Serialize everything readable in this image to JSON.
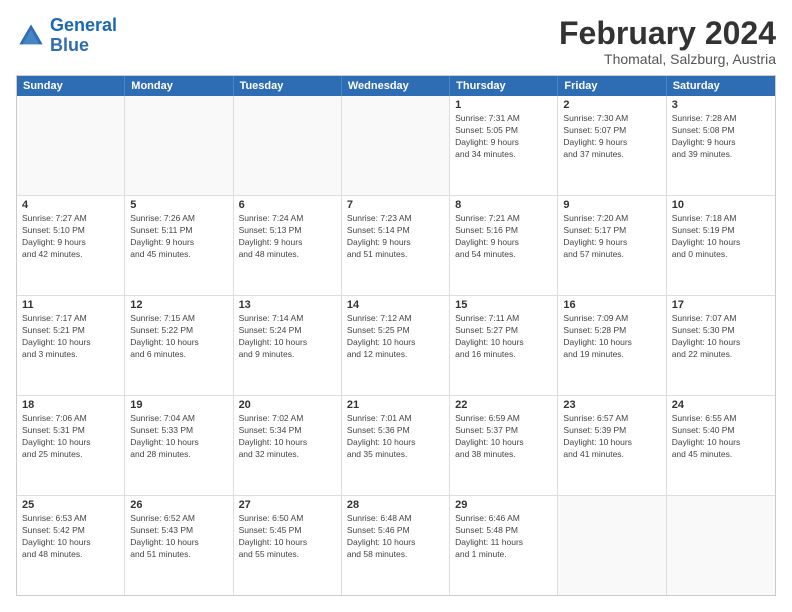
{
  "logo": {
    "line1": "General",
    "line2": "Blue"
  },
  "header": {
    "title": "February 2024",
    "subtitle": "Thomatal, Salzburg, Austria"
  },
  "weekdays": [
    "Sunday",
    "Monday",
    "Tuesday",
    "Wednesday",
    "Thursday",
    "Friday",
    "Saturday"
  ],
  "rows": [
    [
      {
        "day": "",
        "info": ""
      },
      {
        "day": "",
        "info": ""
      },
      {
        "day": "",
        "info": ""
      },
      {
        "day": "",
        "info": ""
      },
      {
        "day": "1",
        "info": "Sunrise: 7:31 AM\nSunset: 5:05 PM\nDaylight: 9 hours\nand 34 minutes."
      },
      {
        "day": "2",
        "info": "Sunrise: 7:30 AM\nSunset: 5:07 PM\nDaylight: 9 hours\nand 37 minutes."
      },
      {
        "day": "3",
        "info": "Sunrise: 7:28 AM\nSunset: 5:08 PM\nDaylight: 9 hours\nand 39 minutes."
      }
    ],
    [
      {
        "day": "4",
        "info": "Sunrise: 7:27 AM\nSunset: 5:10 PM\nDaylight: 9 hours\nand 42 minutes."
      },
      {
        "day": "5",
        "info": "Sunrise: 7:26 AM\nSunset: 5:11 PM\nDaylight: 9 hours\nand 45 minutes."
      },
      {
        "day": "6",
        "info": "Sunrise: 7:24 AM\nSunset: 5:13 PM\nDaylight: 9 hours\nand 48 minutes."
      },
      {
        "day": "7",
        "info": "Sunrise: 7:23 AM\nSunset: 5:14 PM\nDaylight: 9 hours\nand 51 minutes."
      },
      {
        "day": "8",
        "info": "Sunrise: 7:21 AM\nSunset: 5:16 PM\nDaylight: 9 hours\nand 54 minutes."
      },
      {
        "day": "9",
        "info": "Sunrise: 7:20 AM\nSunset: 5:17 PM\nDaylight: 9 hours\nand 57 minutes."
      },
      {
        "day": "10",
        "info": "Sunrise: 7:18 AM\nSunset: 5:19 PM\nDaylight: 10 hours\nand 0 minutes."
      }
    ],
    [
      {
        "day": "11",
        "info": "Sunrise: 7:17 AM\nSunset: 5:21 PM\nDaylight: 10 hours\nand 3 minutes."
      },
      {
        "day": "12",
        "info": "Sunrise: 7:15 AM\nSunset: 5:22 PM\nDaylight: 10 hours\nand 6 minutes."
      },
      {
        "day": "13",
        "info": "Sunrise: 7:14 AM\nSunset: 5:24 PM\nDaylight: 10 hours\nand 9 minutes."
      },
      {
        "day": "14",
        "info": "Sunrise: 7:12 AM\nSunset: 5:25 PM\nDaylight: 10 hours\nand 12 minutes."
      },
      {
        "day": "15",
        "info": "Sunrise: 7:11 AM\nSunset: 5:27 PM\nDaylight: 10 hours\nand 16 minutes."
      },
      {
        "day": "16",
        "info": "Sunrise: 7:09 AM\nSunset: 5:28 PM\nDaylight: 10 hours\nand 19 minutes."
      },
      {
        "day": "17",
        "info": "Sunrise: 7:07 AM\nSunset: 5:30 PM\nDaylight: 10 hours\nand 22 minutes."
      }
    ],
    [
      {
        "day": "18",
        "info": "Sunrise: 7:06 AM\nSunset: 5:31 PM\nDaylight: 10 hours\nand 25 minutes."
      },
      {
        "day": "19",
        "info": "Sunrise: 7:04 AM\nSunset: 5:33 PM\nDaylight: 10 hours\nand 28 minutes."
      },
      {
        "day": "20",
        "info": "Sunrise: 7:02 AM\nSunset: 5:34 PM\nDaylight: 10 hours\nand 32 minutes."
      },
      {
        "day": "21",
        "info": "Sunrise: 7:01 AM\nSunset: 5:36 PM\nDaylight: 10 hours\nand 35 minutes."
      },
      {
        "day": "22",
        "info": "Sunrise: 6:59 AM\nSunset: 5:37 PM\nDaylight: 10 hours\nand 38 minutes."
      },
      {
        "day": "23",
        "info": "Sunrise: 6:57 AM\nSunset: 5:39 PM\nDaylight: 10 hours\nand 41 minutes."
      },
      {
        "day": "24",
        "info": "Sunrise: 6:55 AM\nSunset: 5:40 PM\nDaylight: 10 hours\nand 45 minutes."
      }
    ],
    [
      {
        "day": "25",
        "info": "Sunrise: 6:53 AM\nSunset: 5:42 PM\nDaylight: 10 hours\nand 48 minutes."
      },
      {
        "day": "26",
        "info": "Sunrise: 6:52 AM\nSunset: 5:43 PM\nDaylight: 10 hours\nand 51 minutes."
      },
      {
        "day": "27",
        "info": "Sunrise: 6:50 AM\nSunset: 5:45 PM\nDaylight: 10 hours\nand 55 minutes."
      },
      {
        "day": "28",
        "info": "Sunrise: 6:48 AM\nSunset: 5:46 PM\nDaylight: 10 hours\nand 58 minutes."
      },
      {
        "day": "29",
        "info": "Sunrise: 6:46 AM\nSunset: 5:48 PM\nDaylight: 11 hours\nand 1 minute."
      },
      {
        "day": "",
        "info": ""
      },
      {
        "day": "",
        "info": ""
      }
    ]
  ]
}
